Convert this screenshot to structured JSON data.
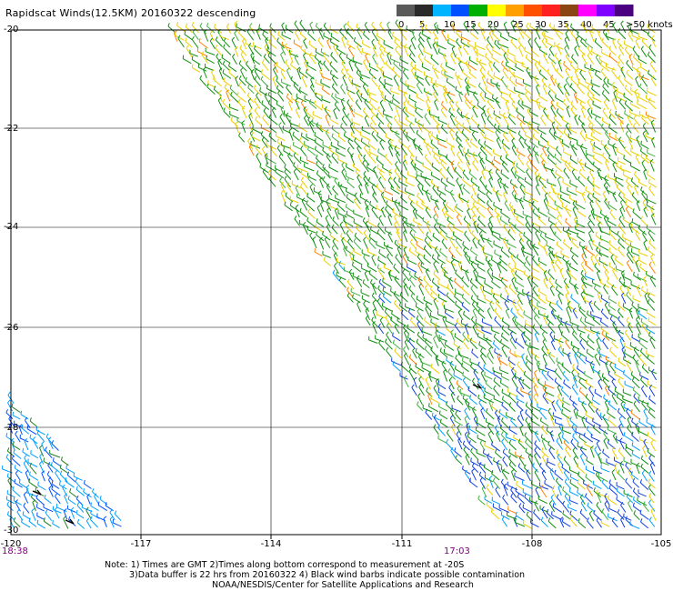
{
  "title": "Rapidscat Winds(12.5KM) 20160322 descending",
  "legend": {
    "labels": [
      "0",
      "5",
      "10",
      "15",
      "20",
      "25",
      "30",
      "35",
      "40",
      "45",
      ">50 knots"
    ],
    "colors": [
      "#5a5a5a",
      "#2a2a2a",
      "#00b4ff",
      "#0050ff",
      "#00b000",
      "#ffff00",
      "#ffa000",
      "#ff5000",
      "#ff2020",
      "#8b4513",
      "#ff00ff",
      "#8000ff",
      "#4b0082"
    ]
  },
  "axes": {
    "lat_labels": [
      "-20",
      "-22",
      "-24",
      "-26",
      "-28",
      "-30"
    ],
    "lon_labels": [
      "-120",
      "-117",
      "-114",
      "-111",
      "-108",
      "-105"
    ]
  },
  "times": {
    "left": "18:38",
    "mid": "17:03"
  },
  "notes": {
    "line1": "Note: 1) Times are GMT 2)Times along bottom correspond to measurement at -20S",
    "line2": "3)Data buffer is 22 hrs from 20160322 4) Black wind barbs indicate possible contamination",
    "line3": "NOAA/NESDIS/Center for Satellite Applications and Research"
  }
}
